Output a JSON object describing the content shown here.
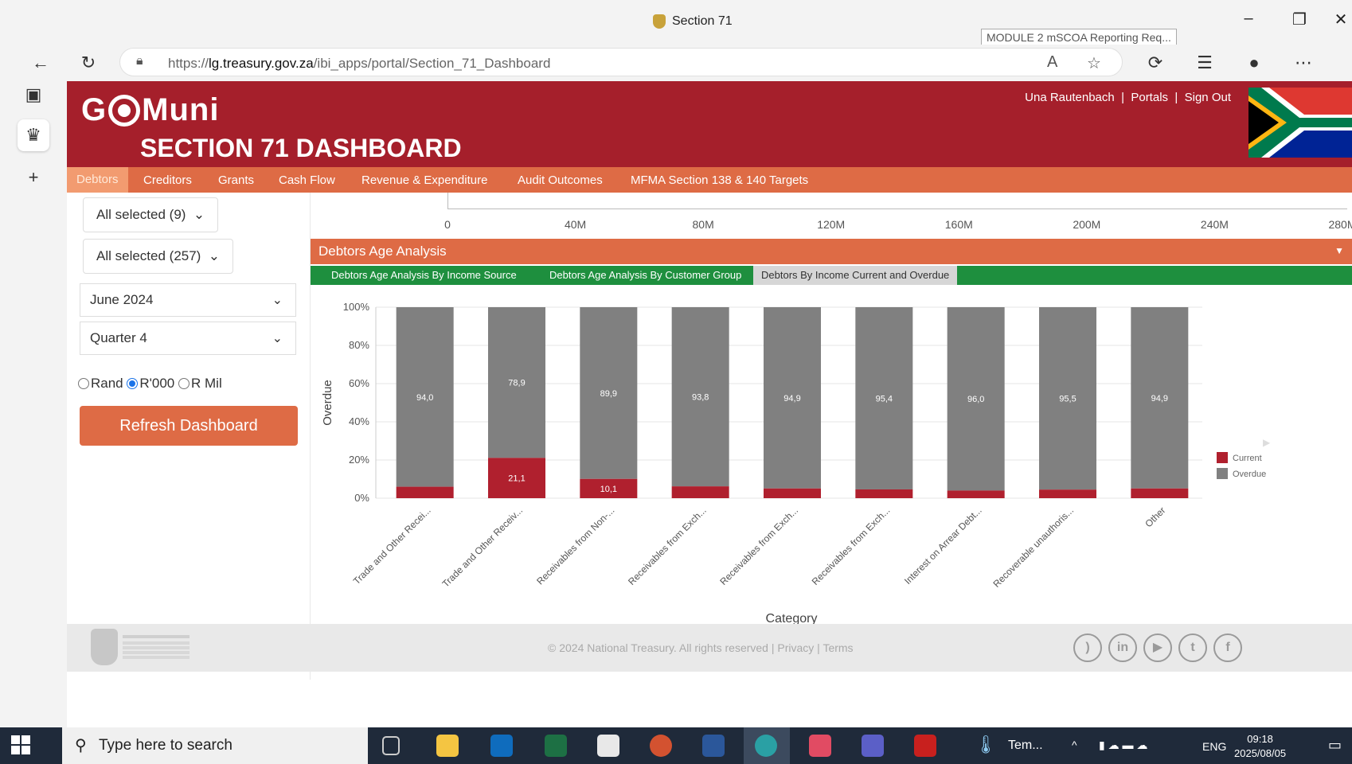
{
  "browser": {
    "tab_title": "Section 71",
    "tooltip": "MODULE 2 mSCOA Reporting Req...",
    "url_prefix": "https://",
    "url_host": "lg.treasury.gov.za",
    "url_path": "/ibi_apps/portal/Section_71_Dashboard"
  },
  "header": {
    "logo_left": "G",
    "logo_right": "Muni",
    "title": "SECTION 71 DASHBOARD",
    "user": "Una Rautenbach",
    "sep": "|",
    "portals": "Portals",
    "sign_out": "Sign Out"
  },
  "menu": [
    "Debtors",
    "Creditors",
    "Grants",
    "Cash Flow",
    "Revenue & Expenditure",
    "Audit Outcomes",
    "MFMA Section 138 & 140 Targets"
  ],
  "filters": {
    "select1": "All selected (9)",
    "select2": "All selected (257)",
    "period": "June 2024",
    "quarter": "Quarter 4",
    "radio_rand": "Rand",
    "radio_r000": "R'000",
    "radio_rmil": "R Mil",
    "refresh": "Refresh Dashboard"
  },
  "top_axis_ticks": [
    "0",
    "40M",
    "80M",
    "120M",
    "160M",
    "200M",
    "240M",
    "280M"
  ],
  "panel": {
    "title": "Debtors Age Analysis",
    "tabs": [
      "Debtors Age Analysis By Income Source",
      "Debtors Age Analysis By Customer Group",
      "Debtors By Income Current and Overdue"
    ]
  },
  "chart_data": {
    "type": "bar",
    "stacked": true,
    "percent": true,
    "xlabel": "Category",
    "ylabel": "Overdue",
    "yticks": [
      "100%",
      "80%",
      "60%",
      "40%",
      "20%",
      "0%"
    ],
    "ylim": [
      0,
      100
    ],
    "categories": [
      "Trade and Other Recei...",
      "Trade and Other Receiv...",
      "Receivables from Non-...",
      "Receivables from Exch...",
      "Receivables from Exch...",
      "Receivables from Exch...",
      "Interest on Arrear Debt...",
      "Recoverable unauthoris...",
      "Other"
    ],
    "series": [
      {
        "name": "Current",
        "color": "#b0202e",
        "values": [
          6.0,
          21.1,
          10.1,
          6.2,
          5.1,
          4.6,
          4.0,
          4.5,
          5.1
        ],
        "labels": [
          "",
          "21,1",
          "10,1",
          "",
          "",
          "",
          "",
          "",
          ""
        ]
      },
      {
        "name": "Overdue",
        "color": "#808080",
        "values": [
          94.0,
          78.9,
          89.9,
          93.8,
          94.9,
          95.4,
          96.0,
          95.5,
          94.9
        ],
        "labels": [
          "94,0",
          "78,9",
          "89,9",
          "93,8",
          "94,9",
          "95,4",
          "96,0",
          "95,5",
          "94,9"
        ]
      }
    ],
    "legend_position": "right"
  },
  "footer": {
    "text": "© 2024 National Treasury. All rights reserved | Privacy | Terms",
    "socials": [
      "rss-icon",
      "linkedin-icon",
      "youtube-icon",
      "twitter-icon",
      "facebook-icon"
    ]
  },
  "taskbar": {
    "search_placeholder": "Type here to search",
    "weather": "Tem...",
    "lang": "ENG",
    "time": "09:18",
    "date": "2025/08/05"
  }
}
